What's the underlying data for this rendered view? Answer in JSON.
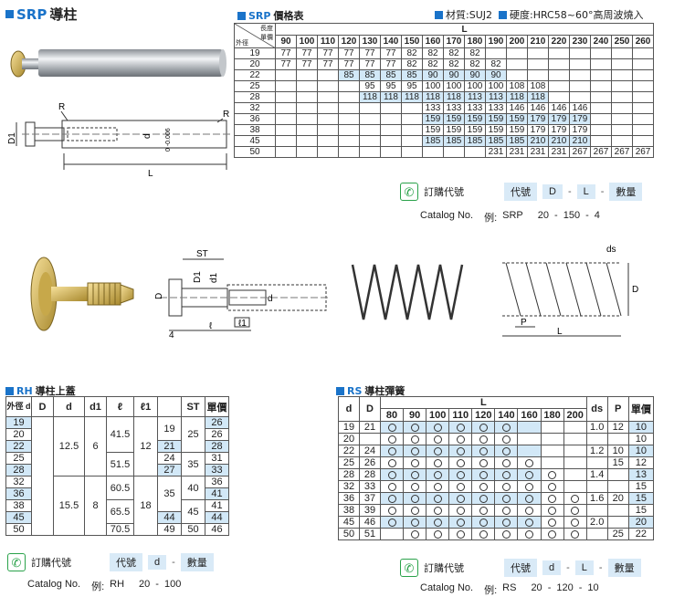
{
  "srp": {
    "title_code": "SRP",
    "title_text": "導柱",
    "table_title_code": "SRP",
    "table_title_text": "價格表",
    "material": "材質:SUJ2",
    "hardness": "硬度:HRC58~60°高周波燒入",
    "header_L": "L",
    "corner_top": "長度",
    "corner_mid": "單價",
    "corner_bottom": "外徑",
    "lengths": [
      "90",
      "100",
      "110",
      "120",
      "130",
      "140",
      "150",
      "160",
      "170",
      "180",
      "190",
      "200",
      "210",
      "220",
      "230",
      "240",
      "250",
      "260"
    ],
    "rows": [
      {
        "d": "19",
        "blue": false,
        "cells": [
          "77",
          "77",
          "77",
          "77",
          "77",
          "77",
          "82",
          "82",
          "82",
          "82",
          "",
          "",
          "",
          "",
          "",
          "",
          "",
          ""
        ]
      },
      {
        "d": "20",
        "blue": false,
        "cells": [
          "77",
          "77",
          "77",
          "77",
          "77",
          "77",
          "82",
          "82",
          "82",
          "82",
          "82",
          "",
          "",
          "",
          "",
          "",
          "",
          ""
        ]
      },
      {
        "d": "22",
        "blue": true,
        "cells": [
          "",
          "",
          "",
          "85",
          "85",
          "85",
          "85",
          "90",
          "90",
          "90",
          "90",
          "",
          "",
          "",
          "",
          "",
          "",
          ""
        ]
      },
      {
        "d": "25",
        "blue": false,
        "cells": [
          "",
          "",
          "",
          "",
          "95",
          "95",
          "95",
          "100",
          "100",
          "100",
          "100",
          "108",
          "108",
          "",
          "",
          "",
          "",
          ""
        ]
      },
      {
        "d": "28",
        "blue": true,
        "cells": [
          "",
          "",
          "",
          "",
          "118",
          "118",
          "118",
          "118",
          "118",
          "113",
          "113",
          "118",
          "118",
          "",
          "",
          "",
          "",
          ""
        ]
      },
      {
        "d": "32",
        "blue": false,
        "cells": [
          "",
          "",
          "",
          "",
          "",
          "",
          "",
          "133",
          "133",
          "133",
          "133",
          "146",
          "146",
          "146",
          "146",
          "",
          "",
          ""
        ]
      },
      {
        "d": "36",
        "blue": true,
        "cells": [
          "",
          "",
          "",
          "",
          "",
          "",
          "",
          "159",
          "159",
          "159",
          "159",
          "159",
          "179",
          "179",
          "179",
          "",
          "",
          ""
        ]
      },
      {
        "d": "38",
        "blue": false,
        "cells": [
          "",
          "",
          "",
          "",
          "",
          "",
          "",
          "159",
          "159",
          "159",
          "159",
          "159",
          "179",
          "179",
          "179",
          "",
          "",
          ""
        ]
      },
      {
        "d": "45",
        "blue": true,
        "cells": [
          "",
          "",
          "",
          "",
          "",
          "",
          "",
          "185",
          "185",
          "185",
          "185",
          "185",
          "210",
          "210",
          "210",
          "",
          "",
          ""
        ]
      },
      {
        "d": "50",
        "blue": false,
        "cells": [
          "",
          "",
          "",
          "",
          "",
          "",
          "",
          "",
          "",
          "",
          "231",
          "231",
          "231",
          "231",
          "267",
          "267",
          "267",
          "267"
        ]
      }
    ],
    "order_label": "訂購代號",
    "order_pills": [
      "代號",
      "D",
      "L",
      "數量"
    ],
    "order_seps": [
      "-",
      "-",
      "-"
    ],
    "catalog_label": "Catalog No.",
    "catalog_example": "例:",
    "catalog_parts": [
      "SRP",
      "20",
      "-",
      "150",
      "-",
      "4"
    ],
    "drawing": {
      "D1": "D1",
      "R": "R",
      "R2": "R",
      "d": "d",
      "tol": "0 -0.006",
      "L": "L"
    }
  },
  "rh": {
    "title_code": "RH",
    "title_text": "導柱上蓋",
    "headers": [
      "外徑 d",
      "D",
      "d",
      "d1",
      "ℓ",
      "ℓ1",
      "",
      "ST",
      "單價"
    ],
    "rows": [
      {
        "dd": "19",
        "blue": true
      },
      {
        "dd": "20",
        "blue": false
      },
      {
        "dd": "22",
        "blue": true
      },
      {
        "dd": "25",
        "blue": false
      },
      {
        "dd": "28",
        "blue": true
      },
      {
        "dd": "32",
        "blue": false
      },
      {
        "dd": "36",
        "blue": true
      },
      {
        "dd": "38",
        "blue": false
      },
      {
        "dd": "45",
        "blue": true
      },
      {
        "dd": "50",
        "blue": false
      }
    ],
    "group1": {
      "d": "12.5",
      "d1": "6",
      "l_a": "41.5",
      "l_b": "51.5",
      "l1": "12",
      "x_a": "19",
      "x_b": "21",
      "x_c": "24",
      "x_d": "27",
      "st_a": "25",
      "st_b": "35"
    },
    "group2": {
      "d": "15.5",
      "d1": "8",
      "l_a": "60.5",
      "l_b": "65.5",
      "l_c": "70.5",
      "l1": "18",
      "x_a": "35",
      "x_b": "44",
      "x_c": "49",
      "st_a": "40",
      "st_b": "45",
      "st_c": "50"
    },
    "prices": [
      "26",
      "26",
      "28",
      "31",
      "33",
      "36",
      "41",
      "41",
      "44",
      "46"
    ],
    "order_label": "訂購代號",
    "order_pills": [
      "代號",
      "d",
      "數量"
    ],
    "order_seps": [
      "-",
      "-"
    ],
    "catalog_label": "Catalog No.",
    "catalog_example": "例:",
    "catalog_parts": [
      "RH",
      "20",
      "-",
      "100"
    ],
    "drawing": {
      "ST": "ST",
      "D1": "D1",
      "d1": "d1",
      "D": "D",
      "d": "d",
      "l": "ℓ",
      "l1": "ℓ1",
      "four": "4"
    }
  },
  "rs": {
    "title_code": "RS",
    "title_text": "導柱彈簧",
    "col_d": "d",
    "col_D": "D",
    "header_L": "L",
    "col_ds": "ds",
    "col_P": "P",
    "col_price": "單價",
    "lengths": [
      "80",
      "90",
      "100",
      "110",
      "120",
      "140",
      "160",
      "180",
      "200"
    ],
    "rows": [
      {
        "d": "19",
        "D": "21",
        "marks": [
          1,
          1,
          1,
          1,
          1,
          1,
          0,
          0,
          0
        ],
        "ds": "1.0",
        "P": "12",
        "price": "10"
      },
      {
        "d": "20",
        "D": "",
        "marks": [
          1,
          1,
          1,
          1,
          1,
          1,
          0,
          0,
          0
        ],
        "ds": "",
        "P": "",
        "price": "10"
      },
      {
        "d": "22",
        "D": "24",
        "marks": [
          1,
          1,
          1,
          1,
          1,
          1,
          0,
          0,
          0
        ],
        "ds": "1.2",
        "P": "10",
        "price": "10"
      },
      {
        "d": "25",
        "D": "26",
        "marks": [
          1,
          1,
          1,
          1,
          1,
          1,
          1,
          0,
          0
        ],
        "ds": "",
        "P": "15",
        "price": "12"
      },
      {
        "d": "28",
        "D": "28",
        "marks": [
          1,
          1,
          1,
          1,
          1,
          1,
          1,
          1,
          0
        ],
        "ds": "1.4",
        "P": "",
        "price": "13"
      },
      {
        "d": "32",
        "D": "33",
        "marks": [
          1,
          1,
          1,
          1,
          1,
          1,
          1,
          1,
          0
        ],
        "ds": "",
        "P": "",
        "price": "15"
      },
      {
        "d": "36",
        "D": "37",
        "marks": [
          1,
          1,
          1,
          1,
          1,
          1,
          1,
          1,
          1
        ],
        "ds": "1.6",
        "P": "20",
        "price": "15"
      },
      {
        "d": "38",
        "D": "39",
        "marks": [
          1,
          1,
          1,
          1,
          1,
          1,
          1,
          1,
          1
        ],
        "ds": "",
        "P": "",
        "price": "15"
      },
      {
        "d": "45",
        "D": "46",
        "marks": [
          1,
          1,
          1,
          1,
          1,
          1,
          1,
          1,
          1
        ],
        "ds": "2.0",
        "P": "",
        "price": "20"
      },
      {
        "d": "50",
        "D": "51",
        "marks": [
          0,
          1,
          1,
          1,
          1,
          1,
          1,
          1,
          1
        ],
        "ds": "",
        "P": "25",
        "price": "22"
      }
    ],
    "order_label": "訂購代號",
    "order_pills": [
      "代號",
      "d",
      "L",
      "數量"
    ],
    "order_seps": [
      "-",
      "-",
      "-"
    ],
    "catalog_label": "Catalog No.",
    "catalog_example": "例:",
    "catalog_parts": [
      "RS",
      "20",
      "-",
      "120",
      "-",
      "10"
    ],
    "drawing": {
      "ds": "ds",
      "D": "D",
      "P": "P",
      "L": "L"
    }
  },
  "colors": {
    "accent": "#1a73c9",
    "row_blue": "#d2e8f7",
    "pill": "#d9eaf7",
    "phone": "#2aa24a"
  }
}
